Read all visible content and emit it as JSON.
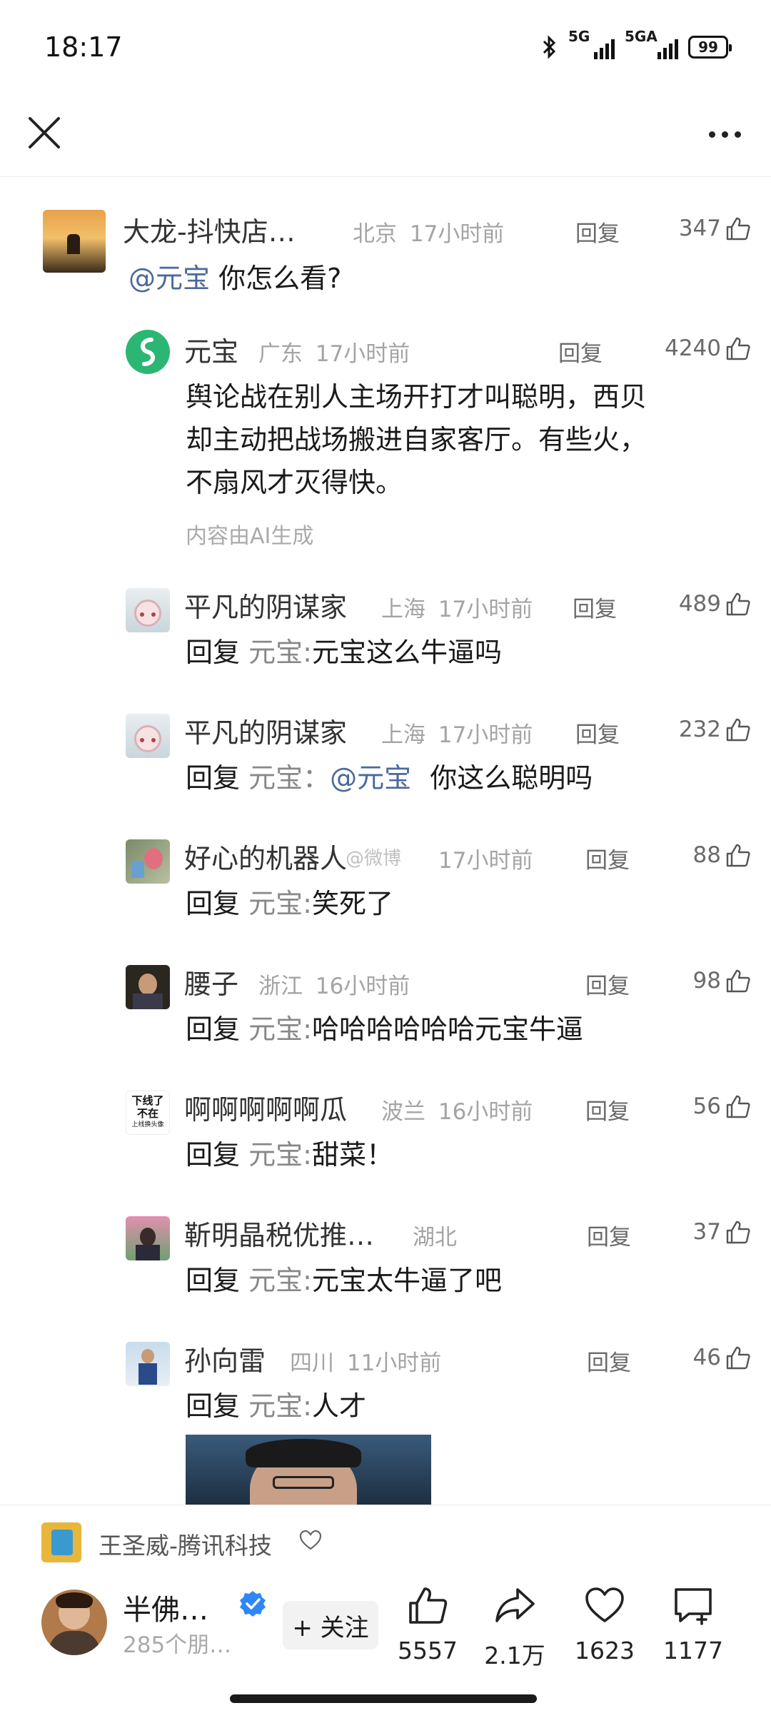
{
  "status_bar": {
    "time": "18:17",
    "sim1": "5G",
    "sim2": "5GA",
    "battery": "99"
  },
  "comments": {
    "top": {
      "username": "大龙-抖快店…",
      "location": "北京",
      "time": "17小时前",
      "reply_label": "回复",
      "likes": "347",
      "mention": "@元宝",
      "text": " 你怎么看?"
    },
    "ai_reply": {
      "username": "元宝",
      "location": "广东",
      "time": "17小时前",
      "reply_label": "回复",
      "likes": "4240",
      "lines": [
        "舆论战在别人主场开打才叫聪明，西贝",
        "却主动把战场搬进自家客厅。有些火，",
        "不扇风才灭得快。"
      ],
      "ai_note": "内容由AI生成"
    },
    "replies": [
      {
        "username": "平凡的阴谋家",
        "location": "上海",
        "time": "17小时前",
        "reply_label": "回复",
        "likes": "489",
        "prefix": "回复",
        "target": "元宝",
        "sep": ":",
        "mention": "",
        "text": "元宝这么牛逼吗"
      },
      {
        "username": "平凡的阴谋家",
        "location": "上海",
        "time": "17小时前",
        "reply_label": "回复",
        "likes": "232",
        "prefix": "回复",
        "target": "元宝",
        "sep": "：",
        "mention": "@元宝",
        "text": "你这么聪明吗"
      },
      {
        "username": "好心的机器人",
        "location": "",
        "time": "17小时前",
        "reply_label": "回复",
        "likes": "88",
        "prefix": "回复",
        "target": "元宝",
        "sep": ":",
        "mention": "",
        "text": "笑死了"
      },
      {
        "username": "腰子",
        "location": "浙江",
        "time": "16小时前",
        "reply_label": "回复",
        "likes": "98",
        "prefix": "回复",
        "target": "元宝",
        "sep": ":",
        "mention": "",
        "text": "哈哈哈哈哈哈元宝牛逼"
      },
      {
        "username": "啊啊啊啊啊瓜",
        "location": "波兰",
        "time": "16小时前",
        "reply_label": "回复",
        "likes": "56",
        "prefix": "回复",
        "target": "元宝",
        "sep": ":",
        "mention": "",
        "text": "甜菜！"
      },
      {
        "username": "靳明晶税优推…",
        "location": "湖北",
        "time": "",
        "reply_label": "回复",
        "likes": "37",
        "prefix": "回复",
        "target": "元宝",
        "sep": ":",
        "mention": "",
        "text": "元宝太牛逼了吧"
      },
      {
        "username": "孙向雷",
        "location": "四川",
        "time": "11小时前",
        "reply_label": "回复",
        "likes": "46",
        "prefix": "回复",
        "target": "元宝",
        "sep": ":",
        "mention": "",
        "text": "人才"
      }
    ],
    "avatar_text": {
      "line1": "下线了",
      "line2": "不在",
      "line3": "上线换头像"
    },
    "watermark": "@微博"
  },
  "bottom": {
    "source_name": "王圣威-腾讯科技",
    "author_name": "半佛…",
    "author_sub": "285个朋…",
    "follow_label": "+ 关注",
    "like_count": "5557",
    "share_count": "2.1万",
    "fav_count": "1623",
    "comment_count": "1177"
  },
  "colors": {
    "mention": "#4a6a99",
    "verified": "#2f86f6",
    "yuanbao": "#2bb673"
  },
  "icons": [
    "close-icon",
    "more-icon",
    "thumb-up-icon",
    "heart-icon",
    "share-icon",
    "comment-icon",
    "verified-icon",
    "bluetooth-icon"
  ]
}
